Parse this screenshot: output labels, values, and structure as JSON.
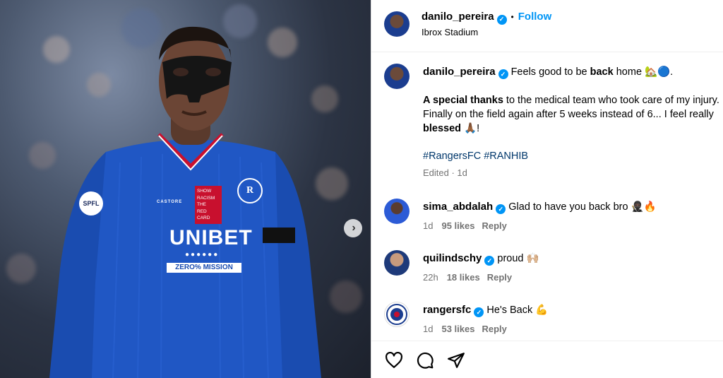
{
  "media": {
    "jersey_sponsor": "UNIBET",
    "jersey_banner": "ZERO% MISSION",
    "jersey_brand": "CASTORE",
    "jersey_patch_lines": [
      "SHOW",
      "RACISM",
      "THE",
      "RED",
      "CARD"
    ],
    "sleeve_badge": "SPFL",
    "next_icon": "chevron-right-icon"
  },
  "header": {
    "username": "danilo_pereira",
    "follow_label": "Follow",
    "location": "Ibrox Stadium"
  },
  "caption": {
    "username": "danilo_pereira",
    "line1_text": "Feels good to be ",
    "line1_bold": "back",
    "line1_end": " home 🏡🔵.",
    "p2_bold1": "A special thanks",
    "p2_text1": " to the medical team who took care of my injury. Finally on the field again after 5 weeks instead of 6... I feel really ",
    "p2_bold2": "blessed",
    "p2_end": " 🙏🏾!",
    "hashtags": "#RangersFC #RANHIB",
    "meta": "Edited · 1d"
  },
  "comments": [
    {
      "username": "sima_abdalah",
      "text": "Glad to have you back bro 🥷🏿🔥",
      "time": "1d",
      "likes": "95 likes",
      "reply": "Reply"
    },
    {
      "username": "quilindschy",
      "text": "proud 🙌🏼",
      "time": "22h",
      "likes": "18 likes",
      "reply": "Reply"
    },
    {
      "username": "rangersfc",
      "text": "He's Back 💪",
      "time": "1d",
      "likes": "53 likes",
      "reply": "Reply"
    }
  ],
  "actions": {
    "like_icon": "heart-icon",
    "comment_icon": "comment-icon",
    "share_icon": "send-icon"
  },
  "colors": {
    "accent": "#0095f6",
    "hashtag": "#00376b",
    "muted": "#737373"
  }
}
